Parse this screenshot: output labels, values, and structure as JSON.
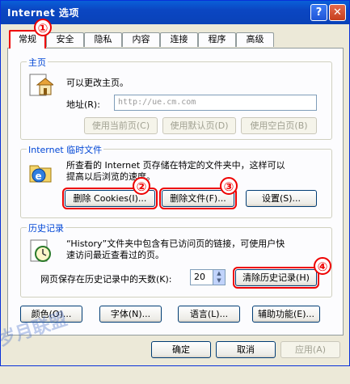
{
  "window": {
    "title": "Internet 选项",
    "help_glyph": "?",
    "close_glyph": "✕"
  },
  "tabs": [
    "常规",
    "安全",
    "隐私",
    "内容",
    "连接",
    "程序",
    "高级"
  ],
  "home": {
    "group_label": "主页",
    "description": "可以更改主页。",
    "address_label": "地址(R):",
    "address_value": "http://ue.cm.com",
    "btn_current": "使用当前页(C)",
    "btn_default": "使用默认页(D)",
    "btn_blank": "使用空白页(B)"
  },
  "temp": {
    "group_label": "Internet 临时文件",
    "description_line1": "所查看的 Internet 页存储在特定的文件夹中，这样可以",
    "description_line2": "提高以后浏览的速度。",
    "btn_cookies": "删除 Cookies(I)...",
    "btn_files": "删除文件(F)...",
    "btn_settings": "设置(S)..."
  },
  "history": {
    "group_label": "历史记录",
    "description_line1": "“History”文件夹中包含有已访问页的链接，可使用户快",
    "description_line2": "速访问最近查看过的页。",
    "days_label": "网页保存在历史记录中的天数(K):",
    "days_value": "20",
    "btn_clear": "清除历史记录(H)"
  },
  "bottom_buttons": {
    "colors": "颜色(O)...",
    "fonts": "字体(N)...",
    "languages": "语言(L)...",
    "accessibility": "辅助功能(E)..."
  },
  "dialog_buttons": {
    "ok": "确定",
    "cancel": "取消",
    "apply": "应用(A)"
  },
  "badges": [
    "①",
    "②",
    "③",
    "④"
  ],
  "watermark": "岁月联盟",
  "colors": {
    "title_bar": "#0942b8",
    "annotation": "#ee0000",
    "group_label": "#0046d5"
  }
}
